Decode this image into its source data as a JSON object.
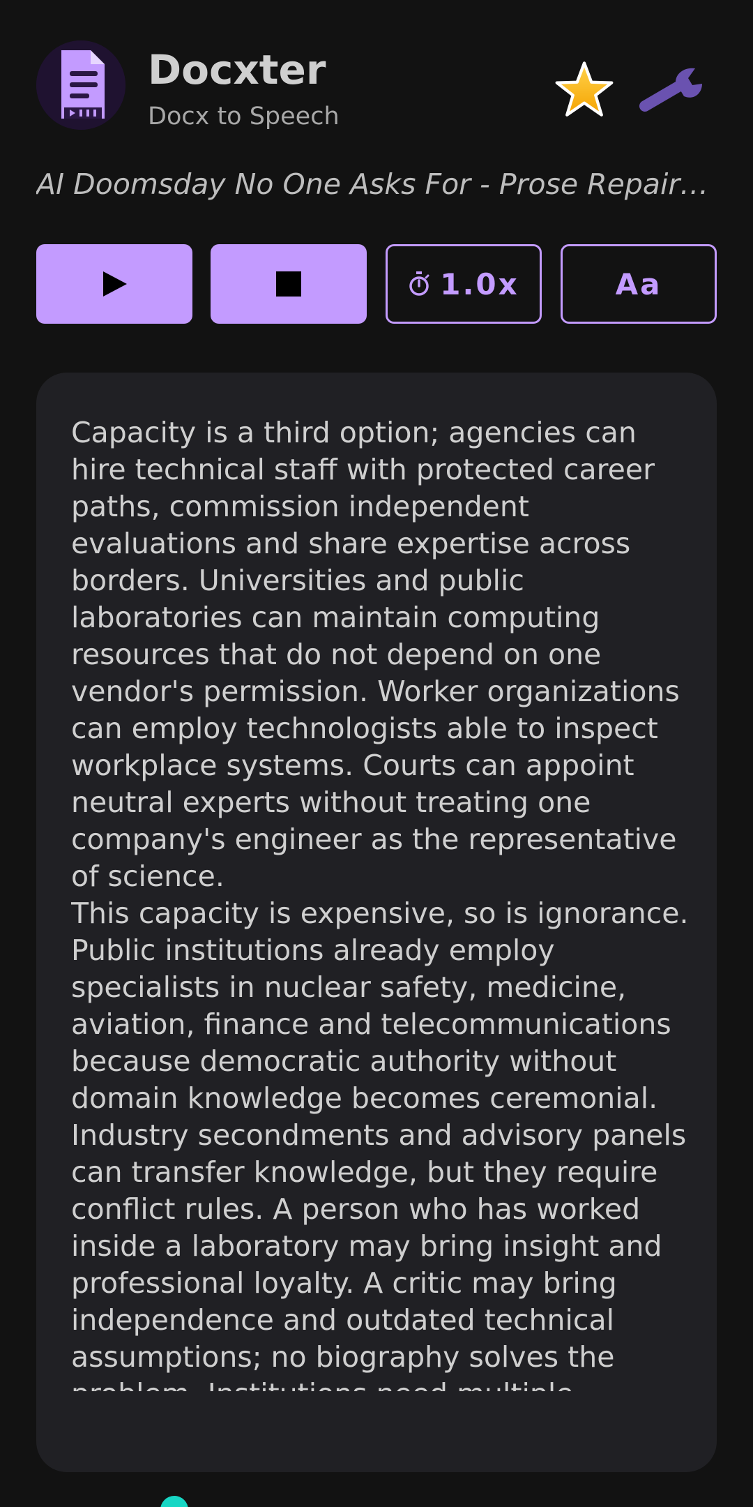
{
  "app": {
    "name": "Docxter",
    "tagline": "Docx to Speech",
    "icon": "document-icon"
  },
  "header": {
    "favorite_icon": "star-icon",
    "settings_icon": "wrench-icon"
  },
  "document": {
    "title": "AI Doomsday No One Asks For - Prose Repaired ..."
  },
  "controls": {
    "play_icon": "play-icon",
    "stop_icon": "stop-icon",
    "speed_icon": "stopwatch-icon",
    "speed_label": "1.0x",
    "font_label": "Aa"
  },
  "reader": {
    "paragraphs": [
      "Capacity is a third option; agencies can hire technical staff with protected career paths, commission independent evaluations and share expertise across borders. Universities and public laboratories can maintain computing resources that do not depend on one vendor's permission. Worker organizations can employ technologists able to inspect workplace systems. Courts can appoint neutral experts without treating one company's engineer as the representative of science.",
      "This capacity is expensive, so is ignorance. Public institutions already employ specialists in nuclear safety, medicine, aviation, finance and telecommunications because democratic authority without domain knowledge becomes ceremonial. Industry secondments and advisory panels can transfer knowledge, but they require conflict rules. A person who has worked inside a laboratory may bring insight and professional loyalty. A critic may bring independence and outdated technical assumptions; no biography solves the problem. Institutions need multiple sources, disclosed interests and the ability to test claims"
    ]
  },
  "colors": {
    "background": "#121212",
    "card": "#202024",
    "accent": "#c39bff",
    "scroll_indicator": "#17d6c4"
  }
}
